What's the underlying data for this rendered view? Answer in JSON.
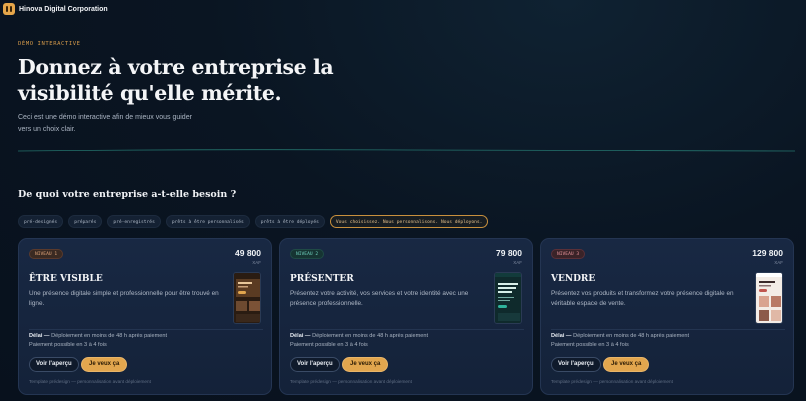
{
  "app": {
    "brand": "Hinova Digital Corporation",
    "accent": "#e2a64e"
  },
  "hero": {
    "eyebrow": "DÉMO INTERACTIVE",
    "title_line1": "Donnez à votre entreprise la",
    "title_line2": "visibilité qu'elle mérite.",
    "subtitle": "Ceci est une démo interactive afin de mieux vous guider vers un choix clair."
  },
  "section": {
    "title": "De quoi votre entreprise a-t-elle besoin ?"
  },
  "chips": [
    "pré-designés",
    "préparés",
    "pré-enregistrés",
    "prêts à être personnalisés",
    "prêts à être déployés",
    "Vous choisissez. Nous personnalisons. Nous déployons."
  ],
  "cards": [
    {
      "level": "NIVEAU 1",
      "price": "49 800",
      "currency": "XAF",
      "title": "ÊTRE VISIBLE",
      "description": "Une présence digitale simple et professionnelle pour être trouvé en ligne.",
      "delay_label": "Délai —",
      "delay_text": "Déploiement en moins de 48 h après paiement",
      "payment": "Paiement possible en 3 à 4 fois",
      "btn_preview": "Voir l'aperçu",
      "btn_want": "Je veux ça",
      "note": "Template prédesign — personnalisation avant déploiement"
    },
    {
      "level": "NIVEAU 2",
      "price": "79 800",
      "currency": "XAF",
      "title": "PRÉSENTER",
      "description": "Présentez votre activité, vos services et votre identité avec une présence professionnelle.",
      "delay_label": "Délai —",
      "delay_text": "Déploiement en moins de 48 h après paiement",
      "payment": "Paiement possible en 3 à 4 fois",
      "btn_preview": "Voir l'aperçu",
      "btn_want": "Je veux ça",
      "note": "Template prédesign — personnalisation avant déploiement"
    },
    {
      "level": "NIVEAU 3",
      "price": "129 800",
      "currency": "XAF",
      "title": "VENDRE",
      "description": "Présentez vos produits et transformez votre présence digitale en véritable espace de vente.",
      "delay_label": "Délai —",
      "delay_text": "Déploiement en moins de 48 h après paiement",
      "payment": "Paiement possible en 3 à 4 fois",
      "btn_preview": "Voir l'aperçu",
      "btn_want": "Je veux ça",
      "note": "Template prédesign — personnalisation avant déploiement"
    }
  ]
}
